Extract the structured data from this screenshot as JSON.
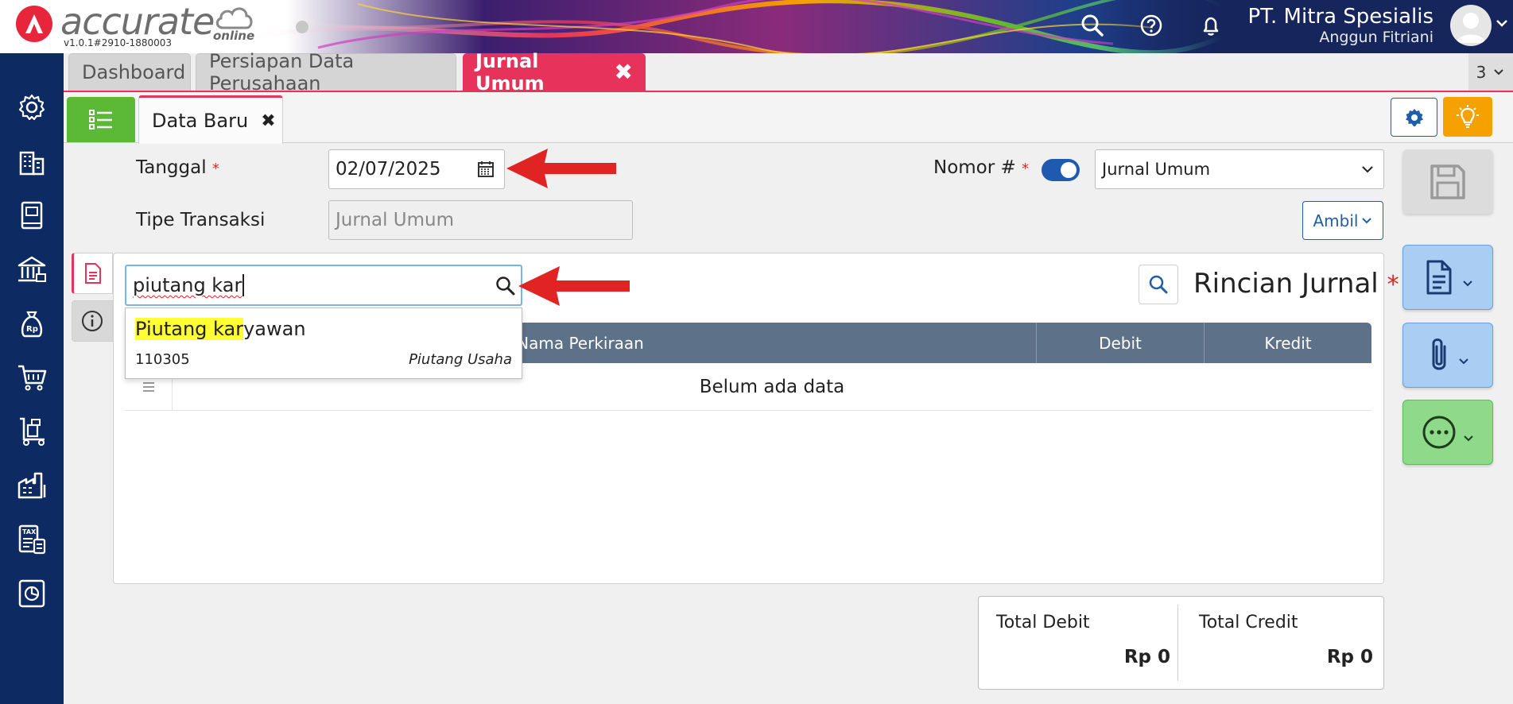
{
  "app": {
    "brand": "accurate",
    "brand_suffix": "online",
    "version": "v1.0.1#2910-1880003",
    "company": "PT. Mitra Spesialis",
    "user": "Anggun Fitriani"
  },
  "sidebar": {
    "items": [
      {
        "icon": "gear-icon"
      },
      {
        "icon": "building-icon"
      },
      {
        "icon": "ledger-book-icon"
      },
      {
        "icon": "bank-icon"
      },
      {
        "icon": "money-bag-icon"
      },
      {
        "icon": "shopping-cart-icon"
      },
      {
        "icon": "hand-truck-icon"
      },
      {
        "icon": "factory-icon"
      },
      {
        "icon": "tax-icon"
      },
      {
        "icon": "report-chart-icon"
      }
    ]
  },
  "tabs": {
    "items": [
      "Dashboard",
      "Persiapan Data Perusahaan",
      "Jurnal Umum"
    ],
    "active": "Jurnal Umum",
    "close_glyph": "✖",
    "count": "3"
  },
  "subtab": {
    "label": "Data Baru",
    "close_glyph": "✖"
  },
  "form": {
    "tanggal_label": "Tanggal",
    "tanggal_value": "02/07/2025",
    "required_mark": "*",
    "tipe_label": "Tipe Transaksi",
    "tipe_placeholder": "Jurnal Umum",
    "nomor_label": "Nomor #",
    "nomor_select": "Jurnal Umum",
    "ambil_label": "Ambil"
  },
  "search": {
    "value": "piutang kar",
    "suggestion": {
      "highlight": "Piutang kar",
      "rest": "yawan",
      "code": "110305",
      "category": "Piutang Usaha"
    }
  },
  "rincian": {
    "title": "Rincian Jurnal",
    "required_mark": "*",
    "columns": [
      "Nama Perkiraan",
      "Debit",
      "Kredit"
    ],
    "empty_text": "Belum ada data"
  },
  "totals": {
    "debit_label": "Total Debit",
    "debit_value": "Rp 0",
    "credit_label": "Total Credit",
    "credit_value": "Rp 0"
  },
  "colors": {
    "accent": "#e7335c",
    "sidebar": "#0d2a63",
    "primary": "#1f5fa8",
    "success": "#5cb935",
    "warning": "#f5a200",
    "annotation_arrow": "#e02424"
  }
}
